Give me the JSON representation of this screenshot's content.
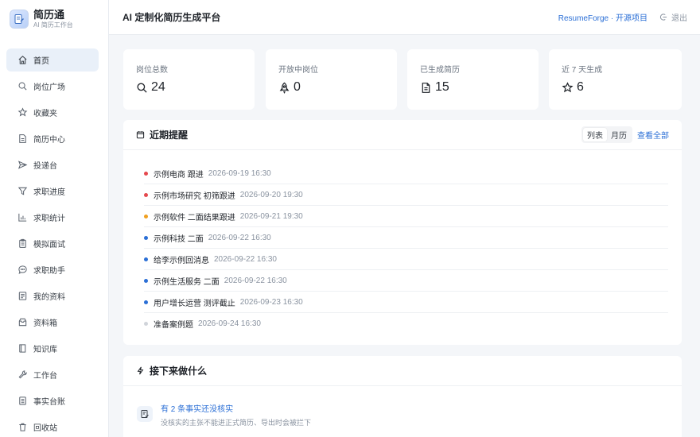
{
  "brand": {
    "name": "简历通",
    "subtitle": "AI 简历工作台"
  },
  "nav": [
    {
      "label": "首页",
      "icon": "home-icon",
      "active": true
    },
    {
      "label": "岗位广场",
      "icon": "search-icon"
    },
    {
      "label": "收藏夹",
      "icon": "star-icon"
    },
    {
      "label": "简历中心",
      "icon": "document-icon"
    },
    {
      "label": "投递台",
      "icon": "send-icon"
    },
    {
      "label": "求职进度",
      "icon": "funnel-icon"
    },
    {
      "label": "求职统计",
      "icon": "bar-chart-icon"
    },
    {
      "label": "模拟面试",
      "icon": "clipboard-icon"
    },
    {
      "label": "求职助手",
      "icon": "chat-icon"
    },
    {
      "label": "我的资料",
      "icon": "profile-icon"
    },
    {
      "label": "资料箱",
      "icon": "inbox-icon"
    },
    {
      "label": "知识库",
      "icon": "book-icon"
    },
    {
      "label": "工作台",
      "icon": "wrench-icon"
    },
    {
      "label": "事实台账",
      "icon": "ledger-icon"
    },
    {
      "label": "回收站",
      "icon": "trash-icon"
    }
  ],
  "header": {
    "title": "AI 定制化简历生成平台",
    "project_link": "ResumeForge · 开源项目",
    "logout": "退出"
  },
  "stats": [
    {
      "label": "岗位总数",
      "value": "24",
      "icon": "search-icon"
    },
    {
      "label": "开放中岗位",
      "value": "0",
      "icon": "rocket-icon"
    },
    {
      "label": "已生成简历",
      "value": "15",
      "icon": "document-icon"
    },
    {
      "label": "近 7 天生成",
      "value": "6",
      "icon": "star-icon"
    }
  ],
  "reminders": {
    "title": "近期提醒",
    "view_list": "列表",
    "view_month": "月历",
    "view_all": "查看全部",
    "items": [
      {
        "title": "示例电商 跟进",
        "time": "2026-09-19 16:30",
        "color": "#e5484d"
      },
      {
        "title": "示例市场研究 初筛跟进",
        "time": "2026-09-20 19:30",
        "color": "#e5484d"
      },
      {
        "title": "示例软件 二面结果跟进",
        "time": "2026-09-21 19:30",
        "color": "#f0a020"
      },
      {
        "title": "示例科技 二面",
        "time": "2026-09-22 16:30",
        "color": "#2b6fd6"
      },
      {
        "title": "给李示例回消息",
        "time": "2026-09-22 16:30",
        "color": "#2b6fd6"
      },
      {
        "title": "示例生活服务 二面",
        "time": "2026-09-22 16:30",
        "color": "#2b6fd6"
      },
      {
        "title": "用户增长运营 测评截止",
        "time": "2026-09-23 16:30",
        "color": "#2b6fd6"
      },
      {
        "title": "准备案例题",
        "time": "2026-09-24 16:30",
        "color": "#d0d4da"
      }
    ]
  },
  "next": {
    "title": "接下来做什么",
    "items": [
      {
        "title": "有 2 条事实还没核实",
        "desc": "没核实的主张不能进正式简历、导出时会被拦下",
        "icon": "checklist-icon"
      }
    ]
  },
  "colors": {
    "accent": "#2b6fd6",
    "active_nav": "#e9f0f9"
  }
}
